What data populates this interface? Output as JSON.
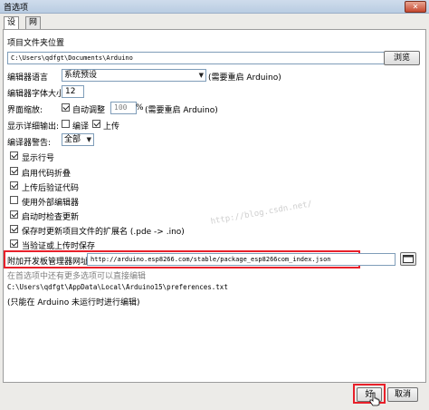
{
  "window": {
    "title": "首选项",
    "close_glyph": "✕"
  },
  "tabs": [
    {
      "label": "设置"
    },
    {
      "label": "网络"
    }
  ],
  "sketchbook": {
    "label": "项目文件夹位置",
    "value": "C:\\Users\\qdfgt\\Documents\\Arduino",
    "browse_label": "浏览"
  },
  "editor_language": {
    "label": "编辑器语言",
    "value": "系统预设",
    "note": "(需要重启 Arduino)"
  },
  "editor_font_size": {
    "label": "编辑器字体大小",
    "value": "12"
  },
  "interface_scale": {
    "label": "界面缩放:",
    "auto_label": "自动调整",
    "auto_checked": true,
    "value": "100",
    "unit": "%",
    "note": "(需要重启 Arduino)"
  },
  "verbose_output": {
    "label": "显示详细输出:",
    "compile_label": "编译",
    "compile_checked": false,
    "upload_label": "上传",
    "upload_checked": true
  },
  "compiler_warnings": {
    "label": "编译器警告:",
    "value": "全部"
  },
  "options": [
    {
      "label": "显示行号",
      "checked": true
    },
    {
      "label": "启用代码折叠",
      "checked": true
    },
    {
      "label": "上传后验证代码",
      "checked": true
    },
    {
      "label": "使用外部编辑器",
      "checked": false
    },
    {
      "label": "启动时检查更新",
      "checked": true
    },
    {
      "label": "保存时更新项目文件的扩展名 (.pde -> .ino)",
      "checked": true
    },
    {
      "label": "当验证或上传时保存",
      "checked": true
    }
  ],
  "watermark": "http://blog.csdn.net/",
  "board_manager": {
    "label": "附加开发板管理器网址:",
    "value": "http://arduino.esp8266.com/stable/package_esp8266com_index.json",
    "accent": "#e8202a"
  },
  "more_prefs_note": "在首选项中还有更多选项可以直接编辑",
  "prefs_path": "C:\\Users\\qdfgt\\AppData\\Local\\Arduino15\\preferences.txt",
  "prefs_hint": "(只能在 Arduino 未运行时进行编辑)",
  "buttons": {
    "ok_label": "好",
    "cancel_label": "取消"
  }
}
